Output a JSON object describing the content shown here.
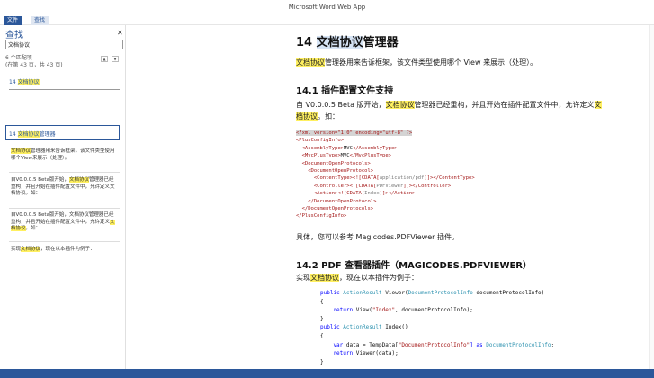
{
  "app": {
    "title": "Microsoft Word Web App"
  },
  "ribbon": {
    "tab_file": "文件",
    "tab_find": "查找"
  },
  "pane": {
    "title": "查找",
    "search_value": "文档协议",
    "match_count": "6 个匹配项",
    "match_page": "(在第 43 页，共 43 页)",
    "heading_result_prefix": "14 ",
    "heading_result_hl": "文档协议",
    "result_prefix": "14 ",
    "result_hl": "文档协议",
    "result_suffix": "管理器",
    "snippet1_hl": "文档协议",
    "snippet1_text": "管理器用来告诉框架，该文件类型使用哪个View来展示（处理）。",
    "snippet2_a": "自V0.0.0.5 Beta版开始，",
    "snippet2_hl": "文档协议",
    "snippet2_b": "管理器已经重构，并且开始在插件配置文件中，允许定义文档协议。如：",
    "snippet3_a": "自V0.0.0.5 Beta版开始，文档协议管理器已经重构，并且开始在插件配置文件中，允许定义",
    "snippet3_hl": "文档协议",
    "snippet3_b": "。如：",
    "snippet4_a": "实现",
    "snippet4_hl": "文档协议",
    "snippet4_b": "，现在以本插件为例子："
  },
  "doc": {
    "h1_num": "14 ",
    "h1_hl": "文档协议",
    "h1_rest": "管理器",
    "p1_hl": "文档协议",
    "p1_rest": "管理器用来告诉框架，该文件类型使用哪个 View 来展示（处理）。",
    "h2a": "14.1 插件配置文件支持",
    "p2_a": "自 V0.0.0.5 Beta 版开始，",
    "p2_hl1": "文档协议",
    "p2_b": "管理器已经重构，并且开始在插件配置文件中，允许定义",
    "p2_hl2": "文档协议",
    "p2_c": "。如：",
    "xml_l1": "<?xml version=\"1.0\" encoding=\"utf-8\" ?>",
    "xml_l2": "<PlusConfigInfo>",
    "xml_l3a": "  <AssemblyType>",
    "xml_l3b": "MVC",
    "xml_l3c": "</AssemblyType>",
    "xml_l4a": "  <MvcPlusType>",
    "xml_l4b": "MVC",
    "xml_l4c": "</MvcPlusType>",
    "xml_l5": "  <DocumentOpenProtocols>",
    "xml_l6": "    <DocumentOpenProtocol>",
    "xml_l7a": "      <ContentType><![CDATA[",
    "xml_l7b": "application/pdf",
    "xml_l7c": "]]></ContentType>",
    "xml_l8a": "      <Controller><![CDATA[",
    "xml_l8b": "PDFViewer",
    "xml_l8c": "]]></Controller>",
    "xml_l9a": "      <Action><![CDATA[",
    "xml_l9b": "Index",
    "xml_l9c": "]]></Action>",
    "xml_l10": "    </DocumentOpenProtocol>",
    "xml_l11": "  </DocumentOpenProtocols>",
    "xml_l12": "</PlusConfigInfo>",
    "p3": "具体，您可以参考 Magicodes.PDFViewer 插件。",
    "h2b": "14.2 PDF 查看器插件（MAGICODES.PDFVIEWER）",
    "p4_a": "实现",
    "p4_hl": "文档协议",
    "p4_b": "，现在以本插件为例子：",
    "c_l1a": "public ",
    "c_l1b": "ActionResult",
    "c_l1c": " Viewer(",
    "c_l1d": "DocumentProtocolInfo",
    "c_l1e": " documentProtocolInfo)",
    "c_l2": "{",
    "c_l3a": "    return ",
    "c_l3b": "View(",
    "c_l3c": "\"Index\"",
    "c_l3d": ", documentProtocolInfo);",
    "c_l4": "}",
    "c_l5a": "public ",
    "c_l5b": "ActionResult",
    "c_l5c": " Index()",
    "c_l6": "{",
    "c_l7a": "    var ",
    "c_l7b": "data = TempData[",
    "c_l7c": "\"DocumentProtocolInfo\"",
    "c_l7d": "] as ",
    "c_l7e": "DocumentProtocolInfo",
    "c_l7f": ";",
    "c_l8a": "    return ",
    "c_l8b": "Viewer(data);",
    "c_l9": "}"
  }
}
